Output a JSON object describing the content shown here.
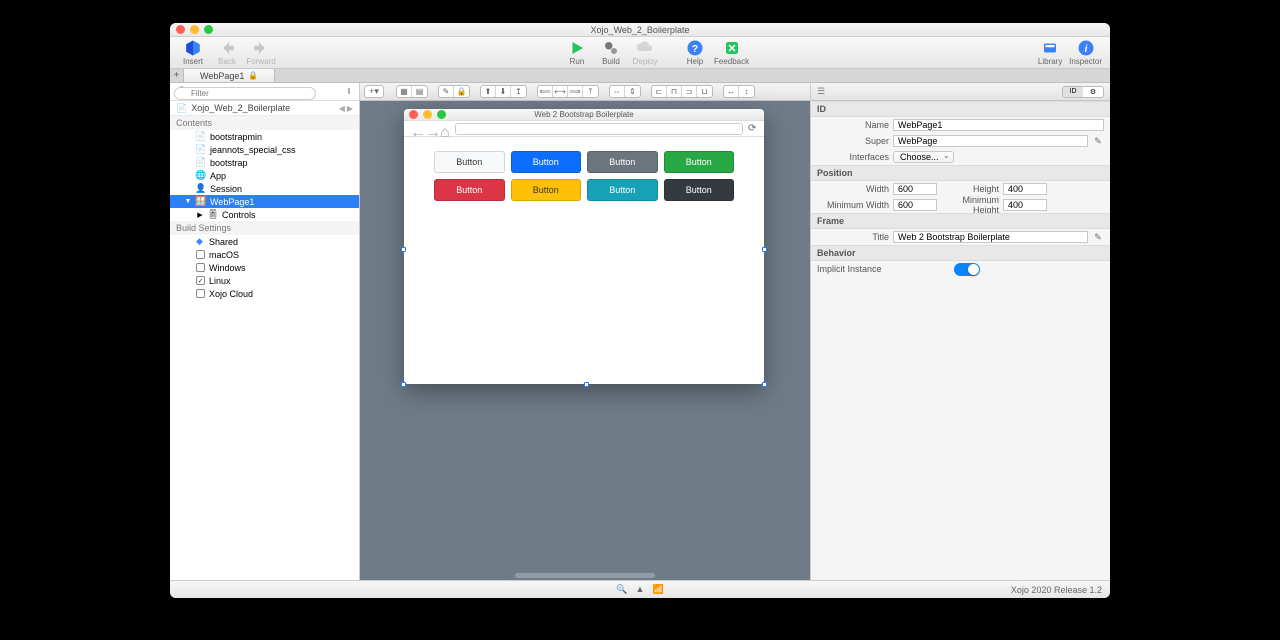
{
  "title": "Xojo_Web_2_Boilerplate",
  "toolbar": {
    "insert": "Insert",
    "back": "Back",
    "forward": "Forward",
    "run": "Run",
    "build": "Build",
    "deploy": "Deploy",
    "help": "Help",
    "feedback": "Feedback",
    "library": "Library",
    "inspector": "Inspector"
  },
  "tab": {
    "label": "WebPage1"
  },
  "filter": {
    "placeholder": "Filter"
  },
  "project": {
    "name": "Xojo_Web_2_Boilerplate"
  },
  "tree": {
    "contents_label": "Contents",
    "items": [
      {
        "label": "bootstrapmin",
        "icon": "css"
      },
      {
        "label": "jeannots_special_css",
        "icon": "css"
      },
      {
        "label": "bootstrap",
        "icon": "css"
      },
      {
        "label": "App",
        "icon": "app"
      },
      {
        "label": "Session",
        "icon": "session"
      },
      {
        "label": "WebPage1",
        "icon": "page",
        "selected": true,
        "expandable": true
      },
      {
        "label": "Controls",
        "icon": "controls",
        "indent": true,
        "expandable": true
      }
    ],
    "build_label": "Build Settings",
    "builds": [
      {
        "label": "Shared",
        "checked": false,
        "shared": true
      },
      {
        "label": "macOS",
        "checked": false
      },
      {
        "label": "Windows",
        "checked": false
      },
      {
        "label": "Linux",
        "checked": true
      },
      {
        "label": "Xojo Cloud",
        "checked": false
      }
    ]
  },
  "designed": {
    "title": "Web 2 Bootstrap Boilerplate",
    "buttons": [
      {
        "label": "Button",
        "style": "b-light"
      },
      {
        "label": "Button",
        "style": "b-primary"
      },
      {
        "label": "Button",
        "style": "b-secondary"
      },
      {
        "label": "Button",
        "style": "b-success"
      },
      {
        "label": "Button",
        "style": "b-danger"
      },
      {
        "label": "Button",
        "style": "b-warning"
      },
      {
        "label": "Button",
        "style": "b-info"
      },
      {
        "label": "Button",
        "style": "b-dark"
      }
    ]
  },
  "inspector": {
    "id_h": "ID",
    "name_l": "Name",
    "name_v": "WebPage1",
    "super_l": "Super",
    "super_v": "WebPage",
    "interfaces_l": "Interfaces",
    "interfaces_v": "Choose...",
    "pos_h": "Position",
    "width_l": "Width",
    "width_v": "600",
    "height_l": "Height",
    "height_v": "400",
    "minw_l": "Minimum Width",
    "minw_v": "600",
    "minh_l": "Minimum Height",
    "minh_v": "400",
    "frame_h": "Frame",
    "title_l": "Title",
    "title_v": "Web 2 Bootstrap Boilerplate",
    "beh_h": "Behavior",
    "implicit_l": "Implicit Instance"
  },
  "statusbar": {
    "version": "Xojo 2020 Release 1.2"
  }
}
